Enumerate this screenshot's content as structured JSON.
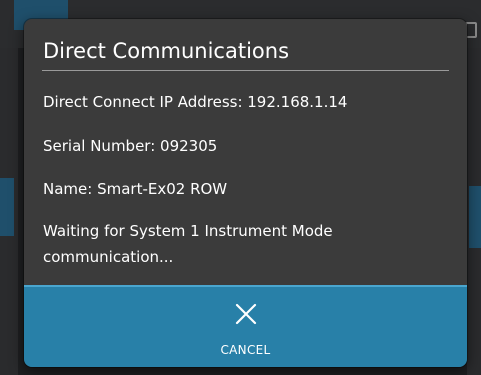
{
  "dialog": {
    "title": "Direct Communications",
    "ip_line": "Direct Connect IP Address: 192.168.1.14",
    "serial_line": "Serial Number: 092305",
    "name_line": "Name: Smart-Ex02 ROW",
    "status_line": "Waiting for System 1 Instrument Mode communication..."
  },
  "cancel_button": {
    "icon": "close-icon",
    "label": "CANCEL"
  },
  "colors": {
    "dialog_background": "#3b3b3b",
    "button_accent": "#2880a8",
    "text": "#ffffff"
  }
}
